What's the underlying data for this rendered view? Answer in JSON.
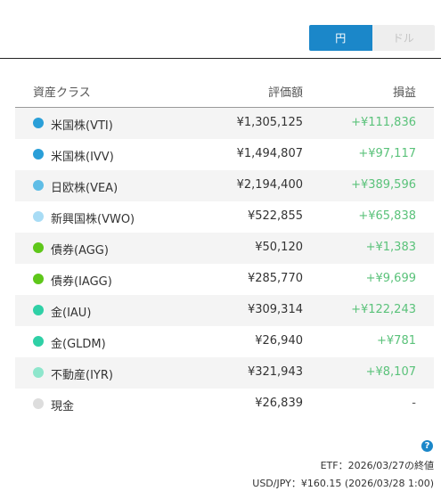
{
  "currency_toggle": {
    "yen_label": "円",
    "dollar_label": "ドル",
    "selected": "円"
  },
  "table": {
    "headers": {
      "asset_class": "資産クラス",
      "valuation": "評価額",
      "profit_loss": "損益"
    },
    "rows": [
      {
        "name": "米国株(VTI)",
        "valuation": "¥1,305,125",
        "profit_loss": "+¥111,836",
        "color": "#2a9fd8"
      },
      {
        "name": "米国株(IVV)",
        "valuation": "¥1,494,807",
        "profit_loss": "+¥97,117",
        "color": "#2a9fd8"
      },
      {
        "name": "日欧株(VEA)",
        "valuation": "¥2,194,400",
        "profit_loss": "+¥389,596",
        "color": "#5fbde6"
      },
      {
        "name": "新興国株(VWO)",
        "valuation": "¥522,855",
        "profit_loss": "+¥65,838",
        "color": "#a8dcf5"
      },
      {
        "name": "債券(AGG)",
        "valuation": "¥50,120",
        "profit_loss": "+¥1,383",
        "color": "#5ec71a"
      },
      {
        "name": "債券(IAGG)",
        "valuation": "¥285,770",
        "profit_loss": "+¥9,699",
        "color": "#5ec71a"
      },
      {
        "name": "金(IAU)",
        "valuation": "¥309,314",
        "profit_loss": "+¥122,243",
        "color": "#2fd0a6"
      },
      {
        "name": "金(GLDM)",
        "valuation": "¥26,940",
        "profit_loss": "+¥781",
        "color": "#2fd0a6"
      },
      {
        "name": "不動産(IYR)",
        "valuation": "¥321,943",
        "profit_loss": "+¥8,107",
        "color": "#8ee6cc"
      },
      {
        "name": "現金",
        "valuation": "¥26,839",
        "profit_loss": "-",
        "color": "#dddddd"
      }
    ]
  },
  "footer": {
    "help_symbol": "?",
    "etf_note": "ETF：2026/03/27の終値",
    "fx_note": "USD/JPY：¥160.15 (2026/03/28 1:00)"
  }
}
